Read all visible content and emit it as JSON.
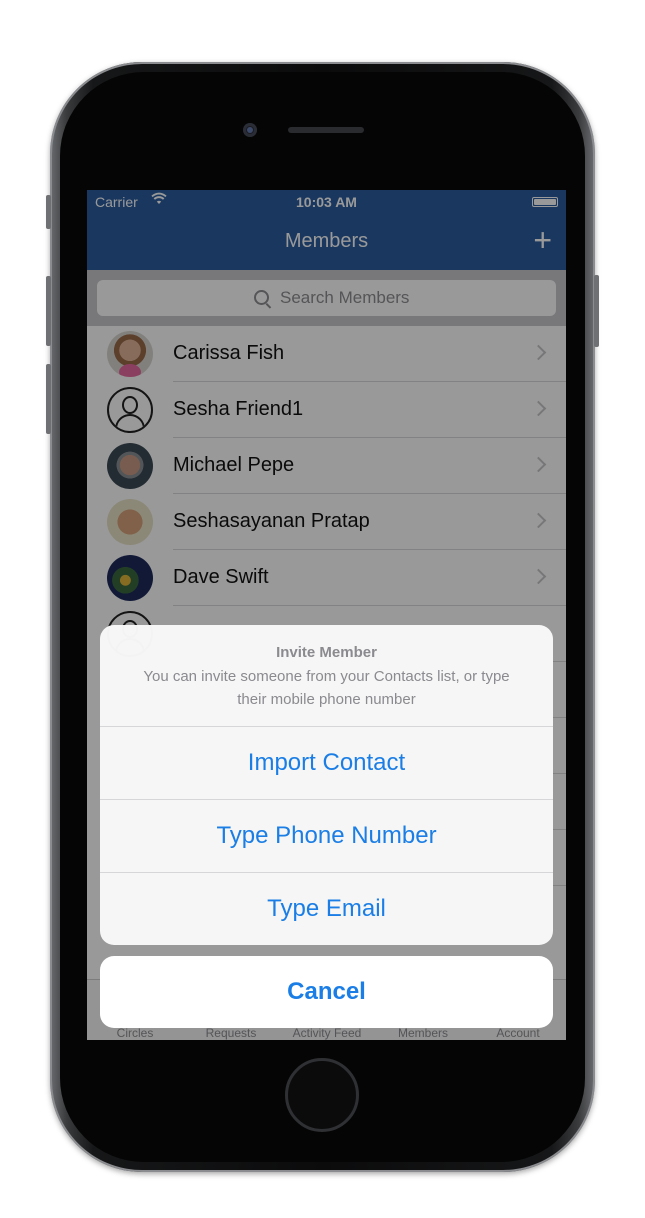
{
  "status": {
    "carrier": "Carrier",
    "time": "10:03 AM"
  },
  "navbar": {
    "title": "Members",
    "add_label": "+"
  },
  "search": {
    "placeholder": "Search Members"
  },
  "members": [
    {
      "name": "Carissa Fish"
    },
    {
      "name": "Sesha Friend1"
    },
    {
      "name": "Michael Pepe"
    },
    {
      "name": "Seshasayanan Pratap"
    },
    {
      "name": "Dave Swift"
    }
  ],
  "tabs": [
    "Circles",
    "Requests",
    "Activity Feed",
    "Members",
    "Account"
  ],
  "sheet": {
    "title": "Invite Member",
    "message": "You can invite someone from your Contacts list, or type their mobile phone number",
    "actions": [
      "Import Contact",
      "Type Phone Number",
      "Type Email"
    ],
    "cancel": "Cancel"
  },
  "colors": {
    "nav_blue": "#2a5d9f",
    "action_blue": "#1a7ee6"
  }
}
